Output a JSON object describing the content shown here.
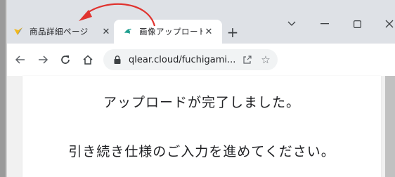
{
  "browser": {
    "tabs": [
      {
        "title": "商品詳細ページ",
        "favicon": "yellow-check-icon",
        "active": false
      },
      {
        "title": "画像アップロード",
        "favicon": "teal-bird-icon",
        "active": true
      }
    ],
    "new_tab_label": "+",
    "window_controls": {
      "tab_search": "chevron-down-icon",
      "minimize": "minimize-icon",
      "maximize": "maximize-icon",
      "close": "close-icon"
    },
    "url": "qlear.cloud/fuchigami...",
    "nav": {
      "back": "back-arrow-icon",
      "forward": "forward-arrow-icon",
      "reload": "reload-icon",
      "home": "home-icon"
    }
  },
  "page": {
    "message_line1": "アップロードが完了しました。",
    "message_line2": "引き続き仕様のご入力を進めてください。"
  },
  "colors": {
    "annotation_arrow": "#e0332f",
    "chrome_frame": "#dee1e6",
    "omnibox_bg": "#f1f3f4"
  }
}
